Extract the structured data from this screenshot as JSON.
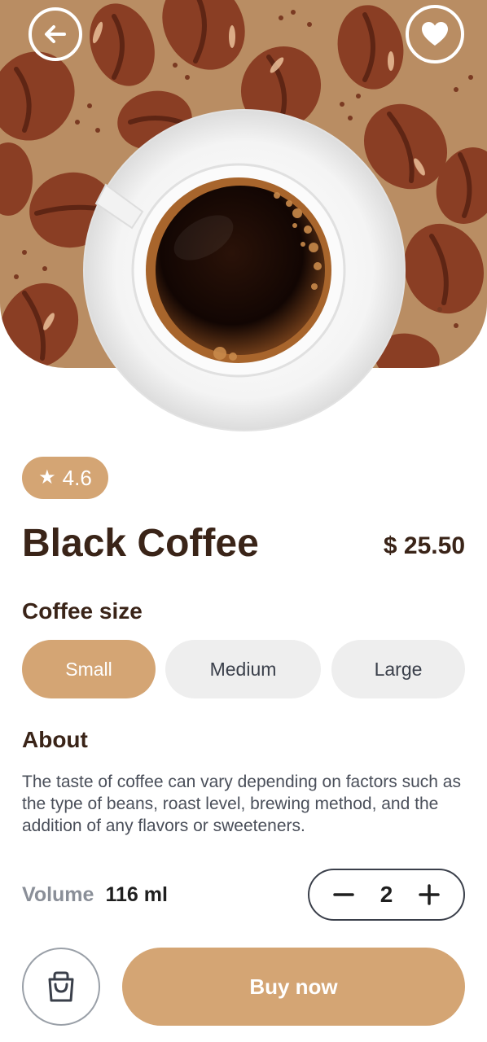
{
  "header": {
    "back_icon": "arrow-left-icon",
    "favorite_icon": "heart-icon"
  },
  "product": {
    "rating": "4.6",
    "rating_icon": "star-icon",
    "name": "Black Coffee",
    "price": "$ 25.50"
  },
  "size_section": {
    "label": "Coffee size",
    "options": [
      "Small",
      "Medium",
      "Large"
    ],
    "selected": "Small"
  },
  "about": {
    "label": "About",
    "text": "The taste of coffee can vary depending on factors such as the type of beans, roast level, brewing method, and the addition of any flavors or sweeteners."
  },
  "volume": {
    "label": "Volume",
    "value": "116 ml"
  },
  "quantity": {
    "value": "2"
  },
  "actions": {
    "cart_icon": "shopping-bag-icon",
    "buy_label": "Buy now"
  },
  "colors": {
    "accent": "#d4a574",
    "hero_background": "#b98d63",
    "bean": "#8a3e24",
    "text_dark": "#3a2418",
    "chip_inactive": "#eeeeee"
  }
}
